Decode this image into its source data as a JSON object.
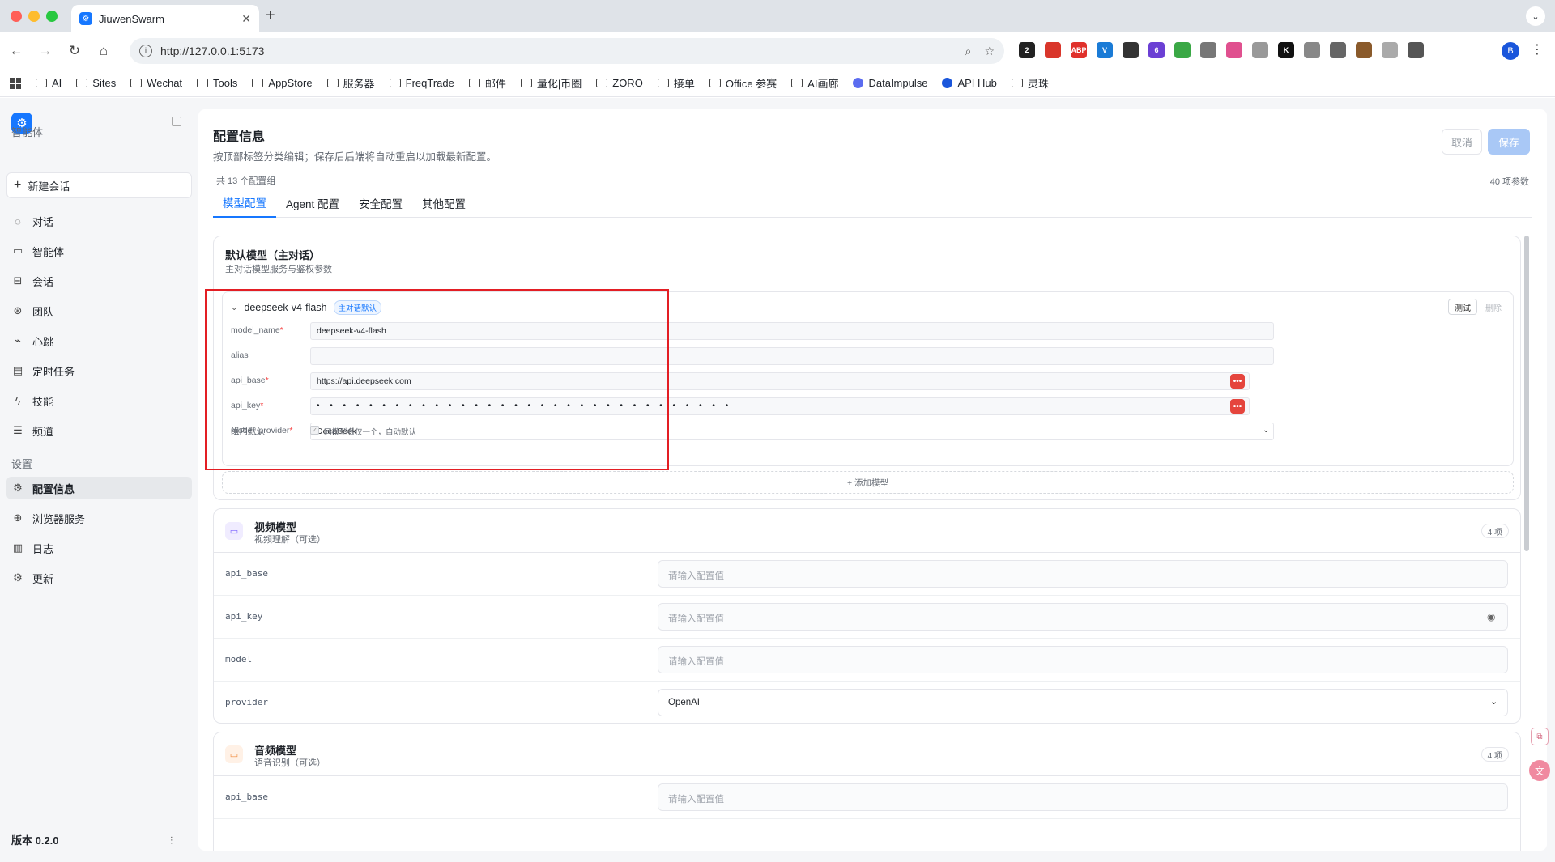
{
  "browser": {
    "tab_title": "JiuwenSwarm",
    "url": "http://127.0.0.1:5173",
    "profile_initial": "B",
    "extensions": [
      {
        "name": "ext-badge-icon",
        "label": "2",
        "color": "#222222"
      },
      {
        "name": "ext-red-icon",
        "label": "",
        "color": "#d9362b"
      },
      {
        "name": "adblock-icon",
        "label": "ABP",
        "color": "#e0312b"
      },
      {
        "name": "ext-v-icon",
        "label": "V",
        "color": "#1a7bd6"
      },
      {
        "name": "ext-dark-icon",
        "label": "",
        "color": "#333333"
      },
      {
        "name": "ext-purple-icon",
        "label": "6",
        "color": "#6b3fd4"
      },
      {
        "name": "ext-grid-icon",
        "label": "",
        "color": "#3aa845"
      },
      {
        "name": "ext-chat-icon",
        "label": "",
        "color": "#777777"
      },
      {
        "name": "ext-pink-icon",
        "label": "",
        "color": "#e0508f"
      },
      {
        "name": "ext-gray-v-icon",
        "label": "",
        "color": "#999999"
      },
      {
        "name": "ext-k-icon",
        "label": "K",
        "color": "#111111"
      },
      {
        "name": "ext-camera-icon",
        "label": "",
        "color": "#888888"
      },
      {
        "name": "ext-circle-icon",
        "label": "",
        "color": "#666666"
      },
      {
        "name": "ext-cookie-icon",
        "label": "",
        "color": "#8a5a2b"
      },
      {
        "name": "ext-doc-icon",
        "label": "",
        "color": "#aaaaaa"
      },
      {
        "name": "extensions-puzzle-icon",
        "label": "",
        "color": "#555555"
      }
    ]
  },
  "bookmarks": [
    {
      "label": "AI",
      "type": "folder"
    },
    {
      "label": "Sites",
      "type": "folder"
    },
    {
      "label": "Wechat",
      "type": "folder"
    },
    {
      "label": "Tools",
      "type": "folder"
    },
    {
      "label": "AppStore",
      "type": "folder"
    },
    {
      "label": "服务器",
      "type": "folder"
    },
    {
      "label": "FreqTrade",
      "type": "folder"
    },
    {
      "label": "邮件",
      "type": "folder"
    },
    {
      "label": "量化|币圈",
      "type": "folder"
    },
    {
      "label": "ZORO",
      "type": "folder"
    },
    {
      "label": "接单",
      "type": "folder"
    },
    {
      "label": "Office 参赛",
      "type": "folder"
    },
    {
      "label": "AI画廊",
      "type": "folder"
    },
    {
      "label": "DataImpulse",
      "type": "site",
      "color": "#5b6cf0"
    },
    {
      "label": "API Hub",
      "type": "site",
      "color": "#1a56db"
    },
    {
      "label": "灵珠",
      "type": "folder"
    }
  ],
  "sidebar": {
    "section_agents": "智能体",
    "new_chat": "新建会话",
    "items": [
      {
        "label": "对话",
        "icon": "chat-icon"
      },
      {
        "label": "智能体",
        "icon": "monitor-icon"
      },
      {
        "label": "会话",
        "icon": "sessions-icon"
      },
      {
        "label": "团队",
        "icon": "team-icon"
      },
      {
        "label": "心跳",
        "icon": "heartbeat-icon"
      },
      {
        "label": "定时任务",
        "icon": "clipboard-icon"
      },
      {
        "label": "技能",
        "icon": "lightning-icon"
      },
      {
        "label": "频道",
        "icon": "list-icon"
      }
    ],
    "section_settings": "设置",
    "settings_items": [
      {
        "label": "配置信息",
        "icon": "gear-icon",
        "active": true
      },
      {
        "label": "浏览器服务",
        "icon": "globe-icon"
      },
      {
        "label": "日志",
        "icon": "log-icon"
      },
      {
        "label": "更新",
        "icon": "update-gear-icon"
      }
    ],
    "version": "版本 0.2.0"
  },
  "page": {
    "title": "配置信息",
    "subtitle": "按顶部标签分类编辑；保存后后端将自动重启以加载最新配置。",
    "cancel": "取消",
    "save": "保存",
    "group_count": "共 13 个配置组",
    "param_count": "40 项参数",
    "tabs": [
      "模型配置",
      "Agent 配置",
      "安全配置",
      "其他配置"
    ],
    "active_tab": 0
  },
  "default_model": {
    "title": "默认模型（主对话）",
    "subtitle": "主对话模型服务与鉴权参数",
    "model_card": {
      "name": "deepseek-v4-flash",
      "badge": "主对话默认",
      "test": "测试",
      "delete": "删除",
      "fields": [
        {
          "key": "model_name",
          "required": true,
          "value": "deepseek-v4-flash"
        },
        {
          "key": "alias",
          "required": false,
          "value": ""
        },
        {
          "key": "api_base",
          "required": true,
          "value": "https://api.deepseek.com"
        },
        {
          "key": "api_key",
          "required": true,
          "value": "• • • • • • • • • • • • • • • • • • • • • • • • • • • • • • • •"
        },
        {
          "key": "model_provider",
          "required": true,
          "value": "DeepSeek"
        }
      ],
      "group_default_label": "组内默认",
      "group_default_hint": "同模型名仅一个，自动默认"
    },
    "add_model": "+ 添加模型"
  },
  "video_model": {
    "title": "视频模型",
    "subtitle": "视频理解（可选）",
    "count": "4 项",
    "icon_color": "#7b61ff",
    "rows": [
      {
        "key": "api_base",
        "placeholder": "请输入配置值"
      },
      {
        "key": "api_key",
        "placeholder": "请输入配置值"
      },
      {
        "key": "model",
        "placeholder": "请输入配置值"
      },
      {
        "key": "provider",
        "value": "OpenAI"
      }
    ]
  },
  "audio_model": {
    "title": "音频模型",
    "subtitle": "语音识别（可选）",
    "count": "4 项",
    "icon_color": "#f08a3c",
    "rows": [
      {
        "key": "api_base",
        "placeholder": "请输入配置值"
      }
    ]
  }
}
